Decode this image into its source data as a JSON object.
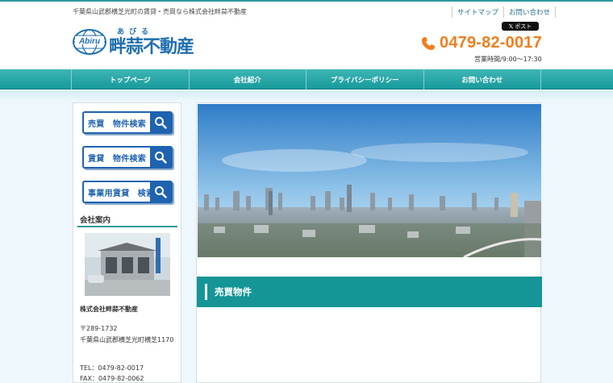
{
  "header": {
    "tagline": "千葉県山武郡横芝光町の賃貸・売買なら株式会社畔蒜不動産",
    "links": [
      "サイトマップ",
      "お問い合わせ"
    ],
    "post_button": "ポスト",
    "logo": {
      "mark_text": "Abiru",
      "ruby": "あびる",
      "name": "畔蒜不動産"
    },
    "phone": "0479-82-0017",
    "hours": "営業時間/9:00～17:30"
  },
  "nav": {
    "items": [
      "トップページ",
      "会社紹介",
      "プライバシーポリシー",
      "お問い合わせ"
    ]
  },
  "sidebar": {
    "search_buttons": [
      "売買　物件検索",
      "賃貸　物件検索",
      "事業用賃貸　検索"
    ],
    "company_heading": "会社案内",
    "company_name": "株式会社畔蒜不動産",
    "zip": "〒289-1732",
    "address": "千葉県山武郡横芝光町横芝1170",
    "tel": "TEL：0479-82-0017",
    "fax": "FAX：0479-82-0062"
  },
  "main": {
    "section_title": "売買物件"
  },
  "colors": {
    "teal": "#179a9b",
    "brand_blue": "#1f63b0",
    "phone_orange": "#f07e1d"
  }
}
